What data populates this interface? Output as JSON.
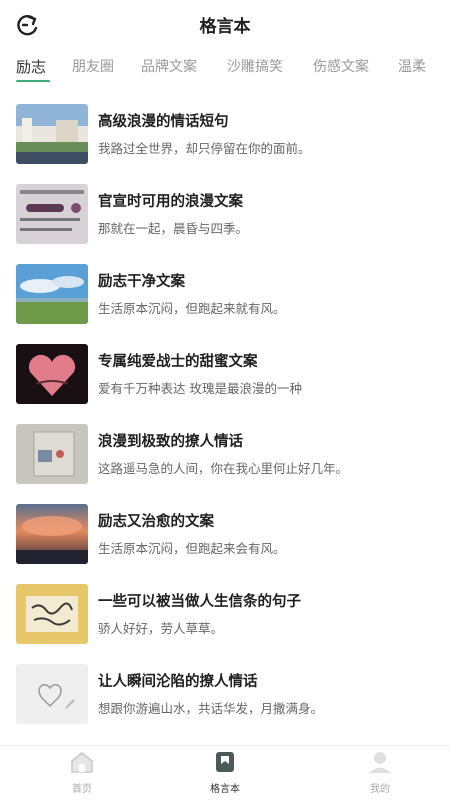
{
  "header": {
    "title": "格言本"
  },
  "tabs": [
    {
      "label": "励志",
      "active": true
    },
    {
      "label": "朋友圈"
    },
    {
      "label": "品牌文案"
    },
    {
      "label": "沙雕搞笑"
    },
    {
      "label": "伤感文案"
    },
    {
      "label": "温柔"
    }
  ],
  "items": [
    {
      "title": "高级浪漫的情话短句",
      "subtitle": "我路过全世界，却只停留在你的面前。"
    },
    {
      "title": "官宣时可用的浪漫文案",
      "subtitle": "那就在一起，晨昏与四季。"
    },
    {
      "title": "励志干净文案",
      "subtitle": "生活原本沉闷，但跑起来就有风。"
    },
    {
      "title": "专属纯爱战士的甜蜜文案",
      "subtitle": "爱有千万种表达 玫瑰是最浪漫的一种"
    },
    {
      "title": "浪漫到极致的撩人情话",
      "subtitle": "这路遥马急的人间，你在我心里何止好几年。"
    },
    {
      "title": "励志又治愈的文案",
      "subtitle": "生活原本沉闷，但跑起来会有风。"
    },
    {
      "title": "一些可以被当做人生信条的句子",
      "subtitle": "骄人好好，劳人草草。"
    },
    {
      "title": "让人瞬间沦陷的撩人情话",
      "subtitle": "想跟你游遍山水，共话华发，月撒满身。"
    }
  ],
  "bottom_nav": [
    {
      "label": "首页",
      "icon": "home-icon"
    },
    {
      "label": "格言本",
      "icon": "bookmark-icon",
      "active": true
    },
    {
      "label": "我的",
      "icon": "user-icon"
    }
  ],
  "colors": {
    "accent": "#3ea97a",
    "text": "#1f1f1f",
    "muted": "#999999"
  }
}
